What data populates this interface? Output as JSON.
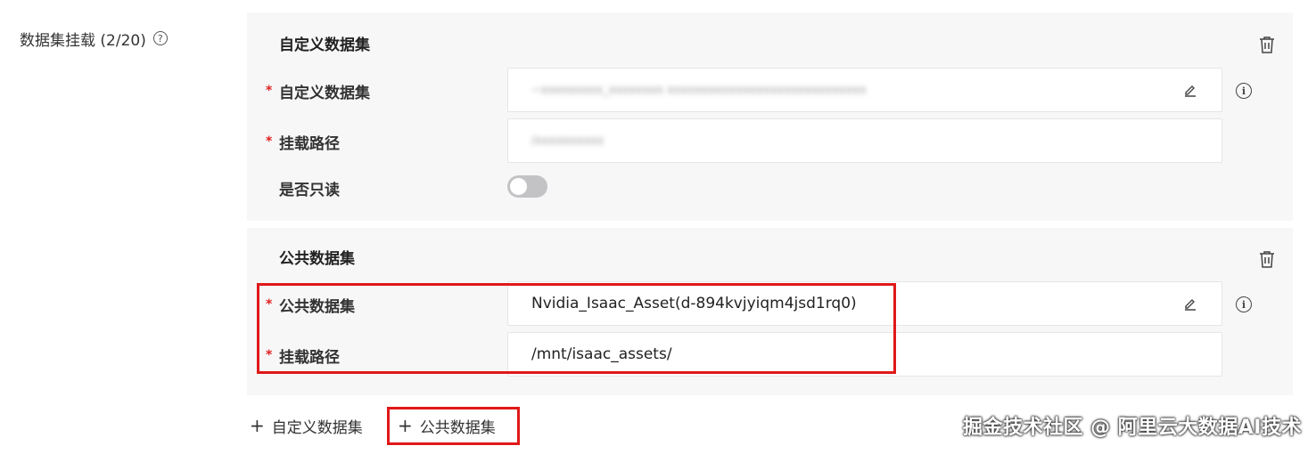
{
  "section": {
    "label": "数据集挂载 (2/20)",
    "help_symbol": "?"
  },
  "custom_card": {
    "title": "自定义数据集",
    "dataset_label": "自定义数据集",
    "dataset_value": "~xxxxxxxxx_xxxxxxxx xxxxxxxxxxxxxxxxxxxxxxxxxxxxx",
    "mount_label": "挂载路径",
    "mount_value": "/xxxxxxxxxx",
    "readonly_label": "是否只读",
    "readonly_on": false
  },
  "public_card": {
    "title": "公共数据集",
    "dataset_label": "公共数据集",
    "dataset_value": "Nvidia_Isaac_Asset(d-894kvjyiqm4jsd1rq0)",
    "mount_label": "挂载路径",
    "mount_value": "/mnt/isaac_assets/"
  },
  "required_mark": "*",
  "info_symbol": "i",
  "actions": {
    "add_custom": "自定义数据集",
    "add_public": "公共数据集",
    "plus": "+"
  },
  "watermark": "掘金技术社区 @ 阿里云大数据AI技术",
  "colors": {
    "highlight": "#e01818",
    "required": "#e02020",
    "card_bg": "#f7f7f8"
  }
}
